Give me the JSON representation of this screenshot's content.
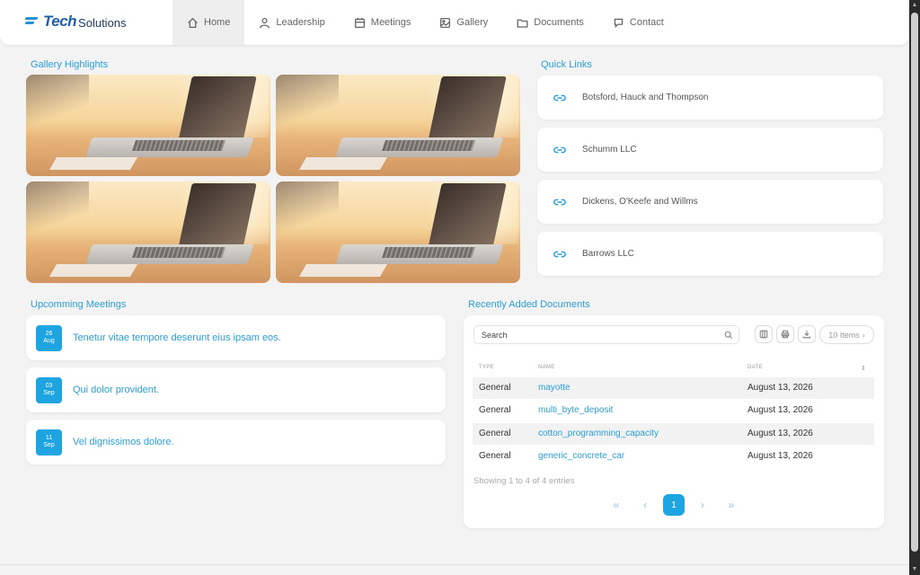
{
  "brand": {
    "tech": "Tech",
    "solutions": "Solutions"
  },
  "nav": [
    {
      "label": "Home",
      "icon": "home-icon"
    },
    {
      "label": "Leadership",
      "icon": "person-icon"
    },
    {
      "label": "Meetings",
      "icon": "calendar-icon"
    },
    {
      "label": "Gallery",
      "icon": "image-icon"
    },
    {
      "label": "Documents",
      "icon": "folder-icon"
    },
    {
      "label": "Contact",
      "icon": "chat-icon"
    }
  ],
  "gallery": {
    "title": "Gallery Highlights"
  },
  "quick_links": {
    "title": "Quick Links",
    "items": [
      "Botsford, Hauck and Thompson",
      "Schumm LLC",
      "Dickens, O'Keefe and Willms",
      "Barrows LLC"
    ]
  },
  "meetings": {
    "title": "Upcomming Meetings",
    "items": [
      {
        "day": "26",
        "month": "Aug",
        "title": "Tenetur vitae tempore deserunt eius ipsam eos."
      },
      {
        "day": "03",
        "month": "Sep",
        "title": "Qui dolor provident."
      },
      {
        "day": "11",
        "month": "Sep",
        "title": "Vel dignissimos dolore."
      }
    ]
  },
  "documents": {
    "title": "Recently Added Documents",
    "search_placeholder": "Search",
    "items_label": "10 Items",
    "columns": [
      "TYPE",
      "NAME",
      "DATE"
    ],
    "rows": [
      {
        "type": "General",
        "name": "mayotte",
        "date": "August 13, 2026"
      },
      {
        "type": "General",
        "name": "multi_byte_deposit",
        "date": "August 13, 2026"
      },
      {
        "type": "General",
        "name": "cotton_programming_capacity",
        "date": "August 13, 2026"
      },
      {
        "type": "General",
        "name": "generic_concrete_car",
        "date": "August 13, 2026"
      }
    ],
    "showing": "Showing 1 to 4 of 4 entries",
    "pagination": {
      "first": "«",
      "prev": "‹",
      "current": "1",
      "next": "›",
      "last": "»"
    }
  },
  "colors": {
    "accent": "#1ea4e1",
    "link": "#2a9fd8",
    "background": "#f3f3f3"
  }
}
